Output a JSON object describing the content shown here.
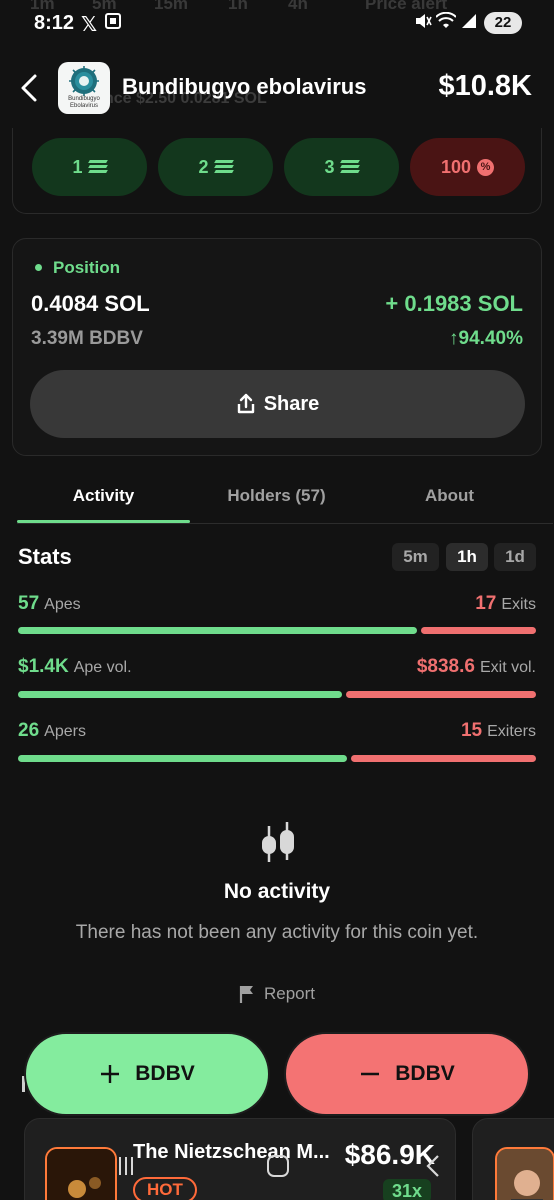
{
  "status_bar": {
    "time": "8:12",
    "x_glyph": "𝕏",
    "battery": "22"
  },
  "ghost_row": {
    "tf_1m": "1m",
    "tf_5m": "5m",
    "tf_15m": "15m",
    "tf_1h": "1h",
    "tf_4h": "4h",
    "price_alert": "Price alert",
    "under_balance": "nce  $2.50    0.0281 SOL"
  },
  "header": {
    "coin_name": "Bundibugyo ebolavirus",
    "market_cap": "$10.8K",
    "logo_line1": "Bundibugyo",
    "logo_line2": "Ebolavirus"
  },
  "quick_buy": {
    "buttons": [
      "1",
      "2",
      "3"
    ],
    "sell_percent": "100"
  },
  "position": {
    "label": "Position",
    "sol_amount": "0.4084 SOL",
    "token_amount": "3.39M BDBV",
    "pnl_sol": "+ 0.1983 SOL",
    "pnl_percent": "↑94.40%",
    "share_label": "Share"
  },
  "tabs": {
    "activity": "Activity",
    "holders": "Holders (57)",
    "about": "About"
  },
  "stats": {
    "title": "Stats",
    "timeframes": [
      "5m",
      "1h",
      "1d"
    ],
    "active_timeframe": "1h",
    "rows": [
      {
        "left_value": "57",
        "left_label": "Apes",
        "right_value": "17",
        "right_label": "Exits",
        "green_fraction": 0.77
      },
      {
        "left_value": "$1.4K",
        "left_label": "Ape vol.",
        "right_value": "$838.6",
        "right_label": "Exit vol.",
        "green_fraction": 0.625
      },
      {
        "left_value": "26",
        "left_label": "Apers",
        "right_value": "15",
        "right_label": "Exiters",
        "green_fraction": 0.635
      }
    ]
  },
  "empty_state": {
    "title": "No activity",
    "subtitle": "There has not been any activity for this coin yet.",
    "report": "Report"
  },
  "actions": {
    "buy_label": "BDBV",
    "sell_label": "BDBV"
  },
  "trending": {
    "name": "The Nietzschean M...",
    "market_cap": "$86.9K",
    "badge": "HOT",
    "multiplier": "31x"
  },
  "colors": {
    "green": "#6fdc8c",
    "red": "#f07070",
    "background": "#121212"
  }
}
